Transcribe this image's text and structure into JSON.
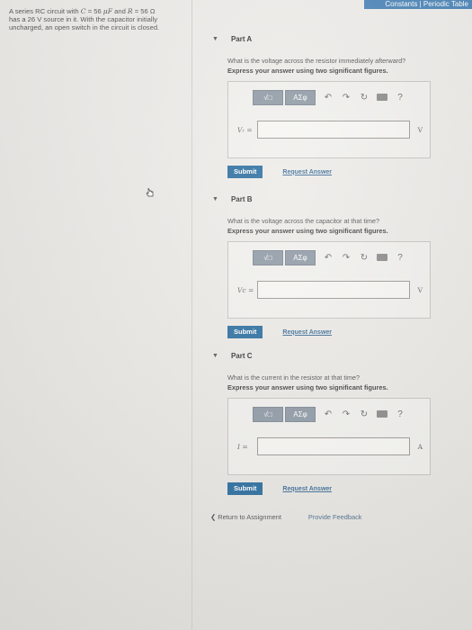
{
  "topbar": {
    "constants": "Constants",
    "separator": " | ",
    "periodic": "Periodic Table"
  },
  "problem": {
    "p1": "A series RC circuit with ",
    "C_var": "C",
    "p2": " = 56 ",
    "mu": "μF",
    "p3": " and ",
    "R_var": "R",
    "p4": " = 56 Ω",
    "p5": "has a 26 V source in it. With the capacitor initially",
    "p6": "uncharged, an open switch in the circuit is closed."
  },
  "parts": [
    {
      "title": "Part A",
      "question": "What is the voltage across the resistor immediately afterward?",
      "instruction": "Express your answer using two significant figures.",
      "label": "Vᵣ =",
      "value": "",
      "unit": "V",
      "submit": "Submit",
      "request": "Request Answer"
    },
    {
      "title": "Part B",
      "question": "What is the voltage across the capacitor at that time?",
      "instruction": "Express your answer using two significant figures.",
      "label": "Vc =",
      "value": "",
      "unit": "V",
      "submit": "Submit",
      "request": "Request Answer"
    },
    {
      "title": "Part C",
      "question": "What is the current in the resistor at that time?",
      "instruction": "Express your answer using two significant figures.",
      "label": "I =",
      "value": "",
      "unit": "A",
      "submit": "Submit",
      "request": "Request Answer"
    }
  ],
  "toolbar": {
    "templates": "√□",
    "greek": "ΑΣφ",
    "undo": "↶",
    "redo": "↷",
    "reset": "↻",
    "keyboard": "keyboard",
    "help": "?"
  },
  "footer": {
    "return": "❮ Return to Assignment",
    "feedback": "Provide Feedback"
  },
  "icons": {
    "caret": "▼",
    "cursor": "pointer-hand-icon"
  },
  "colors": {
    "submit": "#2b6d9f",
    "toolbar_button": "#8f9aa5",
    "topbar": "#4a84b8"
  }
}
